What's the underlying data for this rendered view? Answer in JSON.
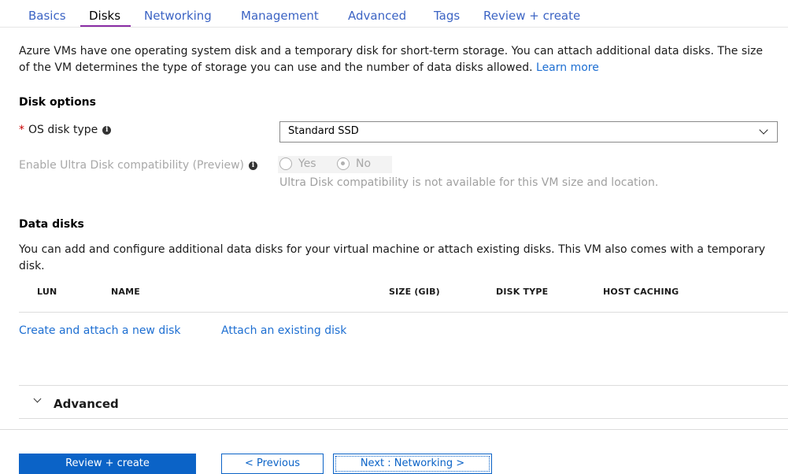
{
  "tabs": [
    {
      "label": "Basics"
    },
    {
      "label": "Disks",
      "active": true
    },
    {
      "label": "Networking"
    },
    {
      "label": "Management"
    },
    {
      "label": "Advanced"
    },
    {
      "label": "Tags"
    },
    {
      "label": "Review + create"
    }
  ],
  "intro": {
    "text": "Azure VMs have one operating system disk and a temporary disk for short-term storage. You can attach additional data disks. The size of the VM determines the type of storage you can use and the number of data disks allowed.",
    "link": "Learn more"
  },
  "disk_options": {
    "title": "Disk options",
    "os_disk_type": {
      "required_mark": "*",
      "label": "OS disk type",
      "value": "Standard SSD"
    },
    "ultra_disk": {
      "label": "Enable Ultra Disk compatibility (Preview)",
      "options": [
        "Yes",
        "No"
      ],
      "selected": "No",
      "note": "Ultra Disk compatibility is not available for this VM size and location."
    }
  },
  "data_disks": {
    "title": "Data disks",
    "description": "You can add and configure additional data disks for your virtual machine or attach existing disks. This VM also comes with a temporary disk.",
    "columns": [
      "LUN",
      "NAME",
      "SIZE (GIB)",
      "DISK TYPE",
      "HOST CACHING"
    ],
    "create_link": "Create and attach a new disk",
    "attach_link": "Attach an existing disk"
  },
  "advanced": {
    "label": "Advanced"
  },
  "footer": {
    "review_create": "Review + create",
    "previous": "< Previous",
    "next": "Next : Networking >"
  },
  "icons": {
    "info": "info-icon",
    "dropdown": "chevron-down-icon",
    "expand": "chevron-down-icon"
  },
  "colors": {
    "accent_link": "#1e6fd2",
    "active_tab_underline": "#8a2da5",
    "primary_button": "#0b63c7",
    "required": "#c80000"
  }
}
